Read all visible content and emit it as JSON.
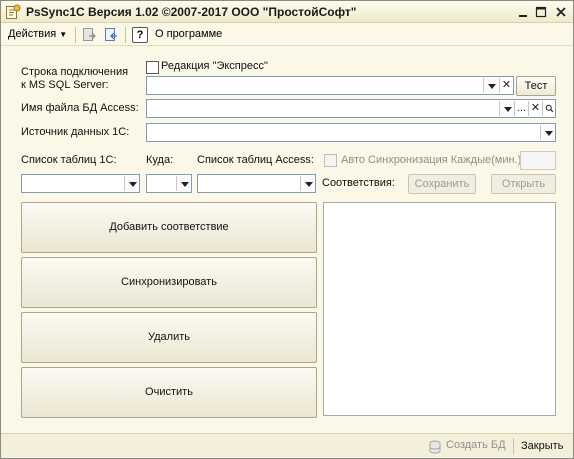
{
  "window": {
    "title": "PsSync1C Версия 1.02 ©2007-2017 ООО \"ПростойСофт\""
  },
  "toolbar": {
    "actions_label": "Действия",
    "about_label": "О программе",
    "help_glyph": "?"
  },
  "form": {
    "express_label": "Редакция \"Экспресс\"",
    "conn_label_line1": "Строка подключения",
    "conn_label_line2": "к MS SQL Server:",
    "conn_value": "",
    "test_button": "Тест",
    "access_file_label": "Имя файла БД Access:",
    "access_file_value": "",
    "ellipsis": "...",
    "clear_glyph": "✕",
    "source_label": "Источник данных 1С:",
    "source_value": "",
    "tables1c_label": "Список таблиц 1С:",
    "where_label": "Куда:",
    "access_tables_label": "Список таблиц Access:",
    "auto_sync_label": "Авто Синхронизация Каждые(мин.)",
    "auto_sync_value": "",
    "matches_label": "Соответствия:",
    "save_button": "Сохранить",
    "open_button": "Открыть"
  },
  "actions": {
    "add_match": "Добавить соответствие",
    "synchronize": "Синхронизировать",
    "delete": "Удалить",
    "clear": "Очистить"
  },
  "bottombar": {
    "create_db": "Создать БД",
    "close": "Закрыть"
  },
  "colors": {
    "window_bg": "#fbf8e7",
    "field_border": "#7f9db9",
    "disabled_text": "#9a9a9a"
  }
}
